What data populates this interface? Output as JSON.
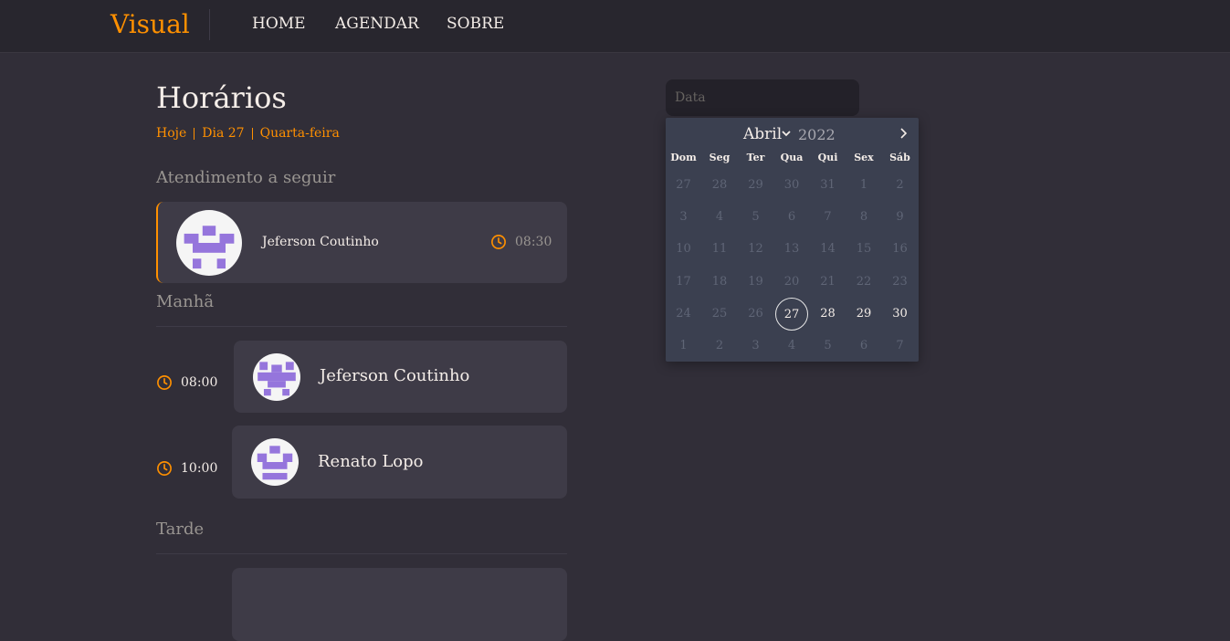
{
  "header": {
    "logo": "Visual",
    "nav": [
      "HOME",
      "AGENDAR",
      "SOBRE"
    ]
  },
  "schedule": {
    "title": "Horários",
    "today_label": "Hoje",
    "day_label": "Dia 27",
    "weekday_label": "Quarta-feira",
    "next_label": "Atendimento a seguir",
    "next": {
      "name": "Jeferson Coutinho",
      "time": "08:30"
    },
    "morning_label": "Manhã",
    "morning": [
      {
        "time": "08:00",
        "name": "Jeferson Coutinho"
      },
      {
        "time": "10:00",
        "name": "Renato Lopo"
      }
    ],
    "afternoon_label": "Tarde"
  },
  "date_picker": {
    "placeholder": "Data",
    "month": "Abril",
    "year": "2022",
    "weekdays": [
      "Dom",
      "Seg",
      "Ter",
      "Qua",
      "Qui",
      "Sex",
      "Sáb"
    ],
    "weeks": [
      [
        "27",
        "28",
        "29",
        "30",
        "31",
        "1",
        "2"
      ],
      [
        "3",
        "4",
        "5",
        "6",
        "7",
        "8",
        "9"
      ],
      [
        "10",
        "11",
        "12",
        "13",
        "14",
        "15",
        "16"
      ],
      [
        "17",
        "18",
        "19",
        "20",
        "21",
        "22",
        "23"
      ],
      [
        "24",
        "25",
        "26",
        "27",
        "28",
        "29",
        "30"
      ],
      [
        "1",
        "2",
        "3",
        "4",
        "5",
        "6",
        "7"
      ]
    ],
    "today": "27",
    "enabled": [
      "27",
      "28",
      "29",
      "30"
    ]
  },
  "colors": {
    "accent": "#ff9000",
    "background": "#312e38",
    "card": "#3e3b47",
    "avatar_pattern": "#9575dc"
  }
}
